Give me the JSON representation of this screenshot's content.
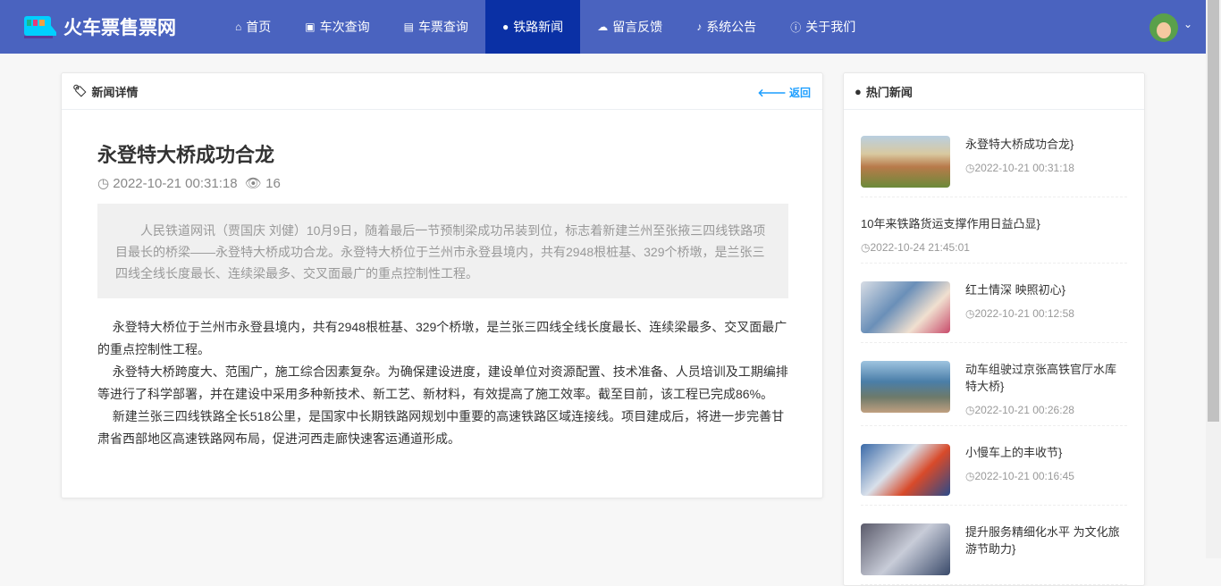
{
  "nav": {
    "brand": "火车票售票网",
    "items": [
      {
        "icon": "home-icon",
        "glyph": "⌂",
        "label": "首页"
      },
      {
        "icon": "train-icon",
        "glyph": "▣",
        "label": "车次查询"
      },
      {
        "icon": "ticket-icon",
        "glyph": "▤",
        "label": "车票查询"
      },
      {
        "icon": "globe-icon",
        "glyph": "●",
        "label": "铁路新闻",
        "active": true
      },
      {
        "icon": "comments-icon",
        "glyph": "☁",
        "label": "留言反馈"
      },
      {
        "icon": "bell-icon",
        "glyph": "♪",
        "label": "系统公告"
      },
      {
        "icon": "info-icon",
        "glyph": "ⓘ",
        "label": "关于我们"
      }
    ]
  },
  "detail": {
    "header": "新闻详情",
    "back": "返回",
    "title": "永登特大桥成功合龙",
    "datetime": "2022-10-21 00:31:18",
    "views": "16",
    "summary": "人民铁道网讯（贾国庆 刘健）10月9日，随着最后一节预制梁成功吊装到位，标志着新建兰州至张掖三四线铁路项目最长的桥梁——永登特大桥成功合龙。永登特大桥位于兰州市永登县境内，共有2948根桩基、329个桥墩，是兰张三四线全线长度最长、连续梁最多、交叉面最广的重点控制性工程。",
    "paragraphs": [
      "永登特大桥位于兰州市永登县境内，共有2948根桩基、329个桥墩，是兰张三四线全线长度最长、连续梁最多、交叉面最广的重点控制性工程。",
      "永登特大桥跨度大、范围广，施工综合因素复杂。为确保建设进度，建设单位对资源配置、技术准备、人员培训及工期编排等进行了科学部署，并在建设中采用多种新技术、新工艺、新材料，有效提高了施工效率。截至目前，该工程已完成86%。",
      "新建兰张三四线铁路全长518公里，是国家中长期铁路网规划中重要的高速铁路区域连接线。项目建成后，将进一步完善甘肃省西部地区高速铁路网布局，促进河西走廊快速客运通道形成。"
    ]
  },
  "hot": {
    "header": "热门新闻",
    "items": [
      {
        "title": "永登特大桥成功合龙}",
        "date": "2022-10-21 00:31:18",
        "img": "linear-gradient(180deg,#b9cfe0 0%,#d9c9a0 35%,#b87a4a 60%,#6b8a3a 100%)"
      },
      {
        "title": "10年来铁路货运支撑作用日益凸显}",
        "date": "2022-10-24 21:45:01"
      },
      {
        "title": "红土情深 映照初心}",
        "date": "2022-10-21 00:12:58",
        "img": "linear-gradient(135deg,#d8dde5,#6a8fb8 40%,#f0e0d0 70%,#c84a6a)"
      },
      {
        "title": "动车组驶过京张高铁官厅水库特大桥}",
        "date": "2022-10-21 00:26:28",
        "img": "linear-gradient(180deg,#9fc4e0 0%,#4a7ea8 40%,#6d7a6a 70%,#c0a080 100%)"
      },
      {
        "title": "小慢车上的丰收节}",
        "date": "2022-10-21 00:16:45",
        "img": "linear-gradient(135deg,#3a6aa8,#d8e0ea 40%,#d84a2a 65%,#2a4a8a)"
      },
      {
        "title": "提升服务精细化水平 为文化旅游节助力}",
        "date": "",
        "img": "linear-gradient(135deg,#5a5a6a,#c8ccd8 50%,#3a4a6a)"
      }
    ]
  }
}
